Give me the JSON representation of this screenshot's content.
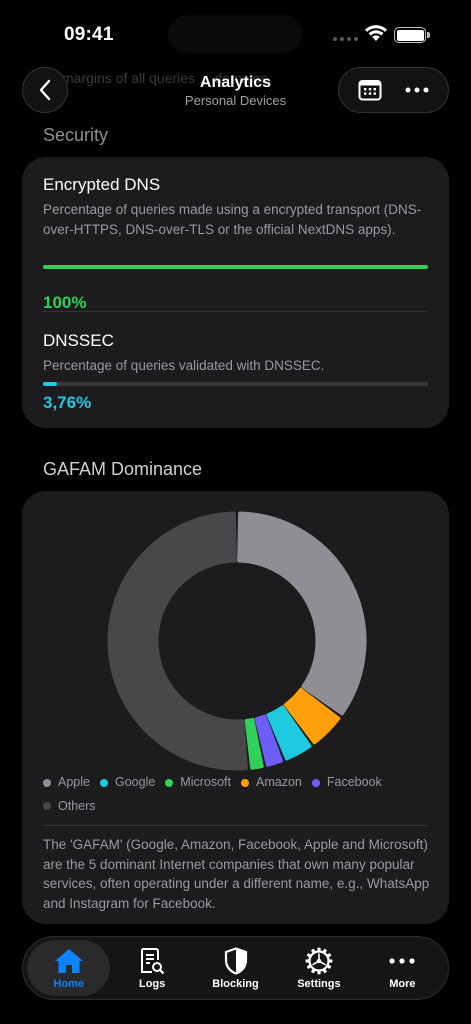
{
  "status_bar": {
    "time": "09:41"
  },
  "background_text": "margins of all queries ... domains.",
  "nav": {
    "title": "Analytics",
    "subtitle": "Personal Devices"
  },
  "security": {
    "section_title": "Security",
    "encrypted_dns": {
      "title": "Encrypted DNS",
      "description": "Percentage of queries made using a encrypted transport (DNS-over-HTTPS, DNS-over-TLS or the official NextDNS apps).",
      "value_label": "100%",
      "fraction": 1.0,
      "color": "#30d158"
    },
    "dnssec": {
      "title": "DNSSEC",
      "description": "Percentage of queries validated with DNSSEC.",
      "value_label": "3,76%",
      "fraction": 0.0376,
      "color": "#1fc9e0"
    }
  },
  "gafam": {
    "section_title": "GAFAM Dominance",
    "description": "The 'GAFAM' (Google, Amazon, Facebook, Apple and Microsoft) are the 5 dominant Internet companies that own many popular services, often operating under a different name, e.g., WhatsApp and Instagram for Facebook."
  },
  "chart_data": {
    "type": "pie",
    "categories": [
      "Apple",
      "Google",
      "Microsoft",
      "Amazon",
      "Facebook",
      "Others"
    ],
    "values": [
      35,
      4,
      2,
      5,
      2.5,
      51.5
    ],
    "order": [
      "Apple",
      "Amazon",
      "Google",
      "Facebook",
      "Microsoft",
      "Others"
    ],
    "colors": {
      "Apple": "#8e8e93",
      "Google": "#1fc9e0",
      "Microsoft": "#30d158",
      "Amazon": "#ff9f0a",
      "Facebook": "#6e5cf6",
      "Others": "#48484a"
    },
    "legend_position": "bottom"
  },
  "tabbar": {
    "items": [
      {
        "label": "Home",
        "icon": "house-icon",
        "active": true
      },
      {
        "label": "Logs",
        "icon": "logs-icon",
        "active": false
      },
      {
        "label": "Blocking",
        "icon": "shield-icon",
        "active": false
      },
      {
        "label": "Settings",
        "icon": "gear-icon",
        "active": false
      },
      {
        "label": "More",
        "icon": "ellipsis-icon",
        "active": false
      }
    ]
  },
  "accent_color": "#0a84ff"
}
